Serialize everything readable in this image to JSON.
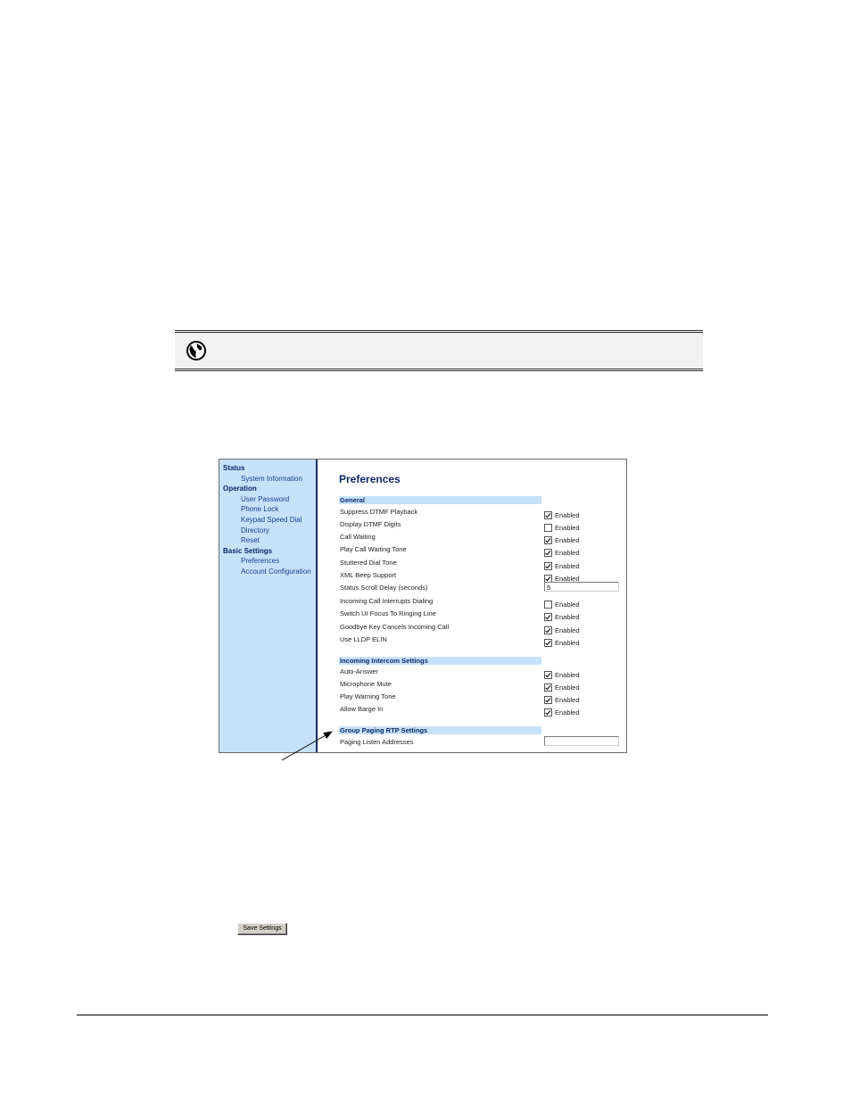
{
  "note": {
    "icon": "globe-icon"
  },
  "ui": {
    "sidebar": {
      "groups": [
        {
          "label": "Status",
          "items": [
            "System Information"
          ]
        },
        {
          "label": "Operation",
          "items": [
            "User Password",
            "Phone Lock",
            "Keypad Speed Dial",
            "Directory",
            "Reset"
          ]
        },
        {
          "label": "Basic Settings",
          "items": [
            "Preferences",
            "Account Configuration"
          ]
        }
      ]
    },
    "page_title": "Preferences",
    "sections": [
      {
        "header": "General",
        "rows": [
          {
            "label": "Suppress DTMF Playback",
            "type": "checkbox",
            "checked": true,
            "option": "Enabled"
          },
          {
            "label": "Display DTMF Digits",
            "type": "checkbox",
            "checked": false,
            "option": "Enabled"
          },
          {
            "label": "Call Waiting",
            "type": "checkbox",
            "checked": true,
            "option": "Enabled"
          },
          {
            "label": "Play Call Waiting Tone",
            "type": "checkbox",
            "checked": true,
            "option": "Enabled"
          },
          {
            "label": "Stuttered Dial Tone",
            "type": "checkbox",
            "checked": true,
            "option": "Enabled"
          },
          {
            "label": "XML Beep Support",
            "type": "checkbox",
            "checked": true,
            "option": "Enabled"
          },
          {
            "label": "Status Scroll Delay (seconds)",
            "type": "text",
            "value": "5"
          },
          {
            "label": "Incoming Call Interrupts Dialing",
            "type": "checkbox",
            "checked": false,
            "option": "Enabled"
          },
          {
            "label": "Switch UI Focus To Ringing Line",
            "type": "checkbox",
            "checked": true,
            "option": "Enabled"
          },
          {
            "label": "Goodbye Key Cancels Incoming Call",
            "type": "checkbox",
            "checked": true,
            "option": "Enabled"
          },
          {
            "label": "Use LLDP ELIN",
            "type": "checkbox",
            "checked": true,
            "option": "Enabled"
          }
        ]
      },
      {
        "header": "Incoming Intercom Settings",
        "rows": [
          {
            "label": "Auto-Answer",
            "type": "checkbox",
            "checked": true,
            "option": "Enabled"
          },
          {
            "label": "Microphone Mute",
            "type": "checkbox",
            "checked": true,
            "option": "Enabled"
          },
          {
            "label": "Play Warning Tone",
            "type": "checkbox",
            "checked": true,
            "option": "Enabled"
          },
          {
            "label": "Allow Barge In",
            "type": "checkbox",
            "checked": true,
            "option": "Enabled"
          }
        ]
      },
      {
        "header": "Group Paging RTP Settings",
        "rows": [
          {
            "label": "Paging Listen Addresses",
            "type": "text",
            "value": ""
          }
        ]
      }
    ]
  },
  "save_button": "Save Settings"
}
